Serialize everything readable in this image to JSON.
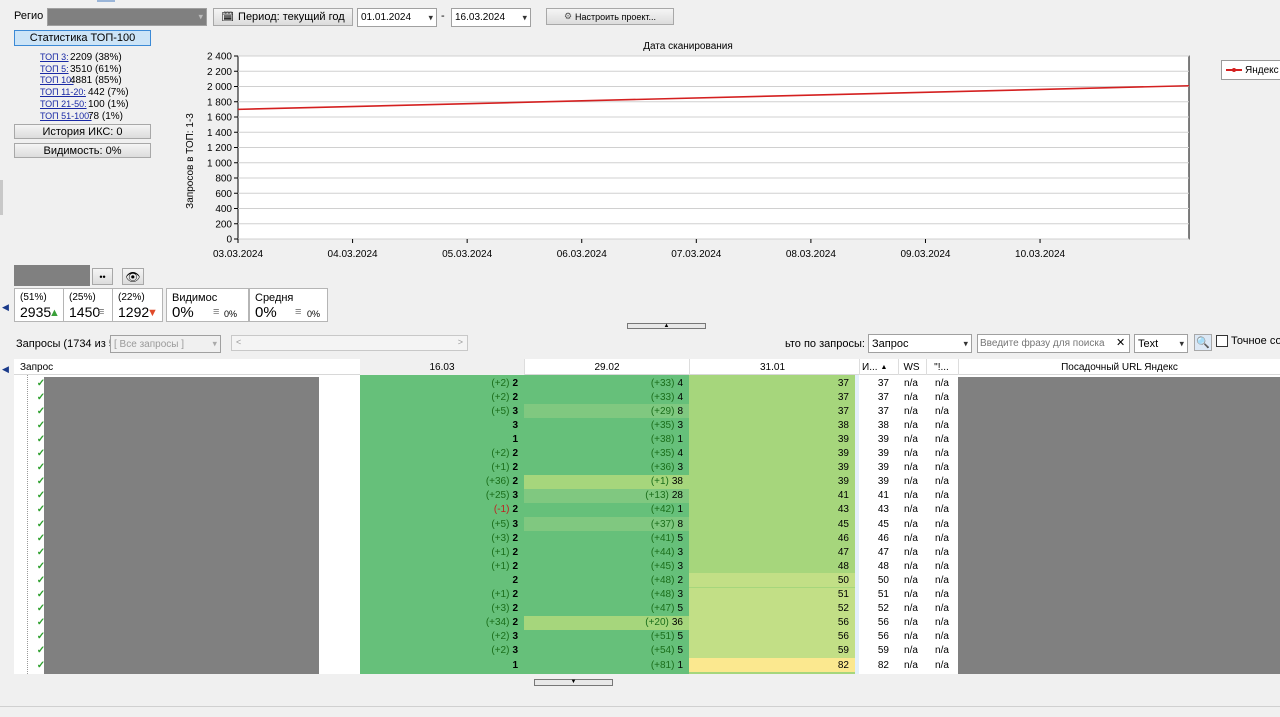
{
  "toolbar": {
    "region_label": "Регио",
    "period_label": "Период: текущий год",
    "date_from": "01.01.2024",
    "date_dash": "-",
    "date_to": "16.03.2024",
    "settings_label": "Настроить проект..."
  },
  "left_panel": {
    "stats_button": "Статистика ТОП-100",
    "stats": [
      {
        "label": "ТОП 3:",
        "value": "2209 (38%)"
      },
      {
        "label": "ТОП 5:",
        "value": "3510 (61%)"
      },
      {
        "label": "ТОП 10:",
        "value": "4881 (85%)"
      },
      {
        "label": "ТОП 11-20:",
        "value": "442 (7%)"
      },
      {
        "label": "ТОП 21-50:",
        "value": "100 (1%)"
      },
      {
        "label": "ТОП 51-100:",
        "value": "78 (1%)"
      }
    ],
    "iks_button": "История ИКС: 0",
    "visibility_button": "Видимость: 0%"
  },
  "chart_data": {
    "type": "line",
    "title": "Дата сканирования",
    "ylabel": "Запросов в ТОП: 1-3",
    "xlabel": "",
    "x": [
      "03.03.2024",
      "04.03.2024",
      "05.03.2024",
      "06.03.2024",
      "07.03.2024",
      "08.03.2024",
      "09.03.2024",
      "10.03.2024"
    ],
    "y_ticks": [
      "0",
      "200",
      "400",
      "600",
      "800",
      "1 000",
      "1 200",
      "1 400",
      "1 600",
      "1 800",
      "2 000",
      "2 200",
      "2 400"
    ],
    "ylim": [
      0,
      2400
    ],
    "xlim_days": [
      0,
      8.3
    ],
    "series": [
      {
        "name": "Яндекс",
        "color": "#d42020",
        "points": [
          [
            0,
            1700
          ],
          [
            8.3,
            2010
          ]
        ]
      }
    ],
    "legend_placement": "right",
    "grid": true
  },
  "summary_cards": [
    {
      "pct": "(51%)",
      "value": "2935"
    },
    {
      "pct": "(25%)",
      "value": "1450"
    },
    {
      "pct": "(22%)",
      "value": "1292"
    },
    {
      "pct": "Видимос",
      "value": "0%",
      "mini": "0%"
    },
    {
      "pct": "Средня",
      "value": "0%",
      "mini": "0%"
    }
  ],
  "filter_bar": {
    "queries_label": "Запросы (1734 из 5",
    "queries_select": "[ Все запросы ]",
    "filter_label": "ьто по запросы:",
    "filter_select": "Запрос",
    "search_placeholder": "Введите фразу для поиска",
    "mode_select": "Text",
    "exact_label": "Точное со"
  },
  "grid": {
    "headers": {
      "query": "Запрос",
      "d1": "16.03",
      "d2": "29.02",
      "d3": "31.01",
      "c4": "И...",
      "c5": "WS",
      "c6": "\"!...",
      "url": "Посадочный URL Яндекс"
    },
    "rows": [
      {
        "d1c": "(+2)",
        "d1": "2",
        "d2c": "(+33)",
        "d2": "4",
        "d3": "37",
        "c4": "37",
        "c5": "n/a",
        "c6": "n/a"
      },
      {
        "d1c": "(+2)",
        "d1": "2",
        "d2c": "(+33)",
        "d2": "4",
        "d3": "37",
        "c4": "37",
        "c5": "n/a",
        "c6": "n/a"
      },
      {
        "d1c": "(+5)",
        "d1": "3",
        "d2c": "(+29)",
        "d2": "8",
        "d3": "37",
        "c4": "37",
        "c5": "n/a",
        "c6": "n/a"
      },
      {
        "d1c": "",
        "d1": "3",
        "d2c": "(+35)",
        "d2": "3",
        "d3": "38",
        "c4": "38",
        "c5": "n/a",
        "c6": "n/a"
      },
      {
        "d1c": "",
        "d1": "1",
        "d2c": "(+38)",
        "d2": "1",
        "d3": "39",
        "c4": "39",
        "c5": "n/a",
        "c6": "n/a"
      },
      {
        "d1c": "(+2)",
        "d1": "2",
        "d2c": "(+35)",
        "d2": "4",
        "d3": "39",
        "c4": "39",
        "c5": "n/a",
        "c6": "n/a"
      },
      {
        "d1c": "(+1)",
        "d1": "2",
        "d2c": "(+36)",
        "d2": "3",
        "d3": "39",
        "c4": "39",
        "c5": "n/a",
        "c6": "n/a"
      },
      {
        "d1c": "(+36)",
        "d1": "2",
        "d2c": "(+1)",
        "d2": "38",
        "d3": "39",
        "c4": "39",
        "c5": "n/a",
        "c6": "n/a"
      },
      {
        "d1c": "(+25)",
        "d1": "3",
        "d2c": "(+13)",
        "d2": "28",
        "d3": "41",
        "c4": "41",
        "c5": "n/a",
        "c6": "n/a"
      },
      {
        "d1c": "(-1)",
        "d1": "2",
        "d2c": "(+42)",
        "d2": "1",
        "d3": "43",
        "c4": "43",
        "c5": "n/a",
        "c6": "n/a"
      },
      {
        "d1c": "(+5)",
        "d1": "3",
        "d2c": "(+37)",
        "d2": "8",
        "d3": "45",
        "c4": "45",
        "c5": "n/a",
        "c6": "n/a"
      },
      {
        "d1c": "(+3)",
        "d1": "2",
        "d2c": "(+41)",
        "d2": "5",
        "d3": "46",
        "c4": "46",
        "c5": "n/a",
        "c6": "n/a"
      },
      {
        "d1c": "(+1)",
        "d1": "2",
        "d2c": "(+44)",
        "d2": "3",
        "d3": "47",
        "c4": "47",
        "c5": "n/a",
        "c6": "n/a"
      },
      {
        "d1c": "(+1)",
        "d1": "2",
        "d2c": "(+45)",
        "d2": "3",
        "d3": "48",
        "c4": "48",
        "c5": "n/a",
        "c6": "n/a"
      },
      {
        "d1c": "",
        "d1": "2",
        "d2c": "(+48)",
        "d2": "2",
        "d3": "50",
        "c4": "50",
        "c5": "n/a",
        "c6": "n/a"
      },
      {
        "d1c": "(+1)",
        "d1": "2",
        "d2c": "(+48)",
        "d2": "3",
        "d3": "51",
        "c4": "51",
        "c5": "n/a",
        "c6": "n/a"
      },
      {
        "d1c": "(+3)",
        "d1": "2",
        "d2c": "(+47)",
        "d2": "5",
        "d3": "52",
        "c4": "52",
        "c5": "n/a",
        "c6": "n/a"
      },
      {
        "d1c": "(+34)",
        "d1": "2",
        "d2c": "(+20)",
        "d2": "36",
        "d3": "56",
        "c4": "56",
        "c5": "n/a",
        "c6": "n/a"
      },
      {
        "d1c": "(+2)",
        "d1": "3",
        "d2c": "(+51)",
        "d2": "5",
        "d3": "56",
        "c4": "56",
        "c5": "n/a",
        "c6": "n/a"
      },
      {
        "d1c": "(+2)",
        "d1": "3",
        "d2c": "(+54)",
        "d2": "5",
        "d3": "59",
        "c4": "59",
        "c5": "n/a",
        "c6": "n/a"
      },
      {
        "d1c": "",
        "d1": "1",
        "d2c": "(+81)",
        "d2": "1",
        "d3": "82",
        "c4": "82",
        "c5": "n/a",
        "c6": "n/a"
      }
    ]
  }
}
